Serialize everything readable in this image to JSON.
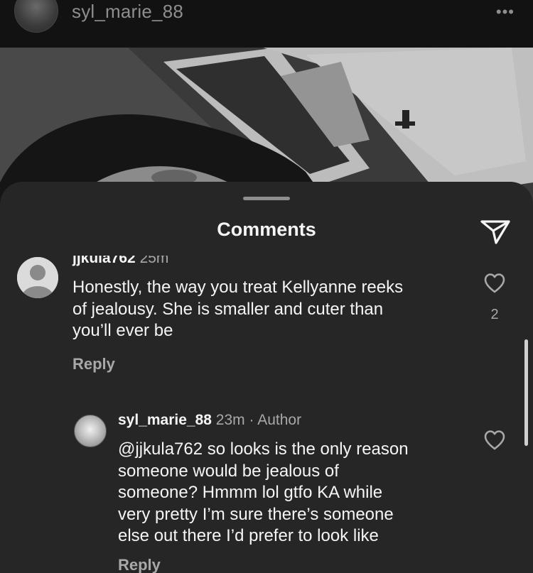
{
  "post": {
    "username": "syl_marie_88",
    "more_label": "•••"
  },
  "sheet": {
    "title": "Comments"
  },
  "comments": [
    {
      "username": "jjkula762",
      "time": "25m",
      "text_lines": [
        "Honestly, the way you treat Kellyanne reeks",
        "of jealousy. She is smaller and cuter than",
        "you’ll ever be"
      ],
      "reply_label": "Reply",
      "like_count": "2"
    },
    {
      "username": "syl_marie_88",
      "time": "23m",
      "separator": "·",
      "badge": "Author",
      "text_lines": [
        "@jjkula762 so looks is the only reason",
        "someone would be jealous of",
        "someone? Hmmm lol gtfo KA while",
        "very pretty I’m sure there’s someone",
        "else out there I’d prefer to look like"
      ],
      "reply_label": "Reply"
    }
  ],
  "icons": {
    "share": "paper-plane-icon",
    "like": "heart-outline-icon",
    "avatar_default": "default-avatar-icon",
    "more": "more-dots-icon"
  },
  "colors": {
    "sheet_background": "#262626",
    "primary_text": "#f5f5f5",
    "secondary_text": "#a8a8a8"
  }
}
